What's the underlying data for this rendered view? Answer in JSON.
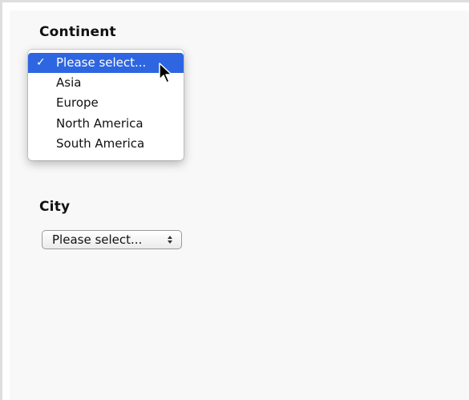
{
  "continent": {
    "label": "Continent",
    "options": [
      "Please select...",
      "Asia",
      "Europe",
      "North America",
      "South America"
    ],
    "selected_index": 0,
    "check_mark": "✓"
  },
  "city": {
    "label": "City",
    "value": "Please select..."
  },
  "colors": {
    "highlight": "#2d66e0"
  }
}
